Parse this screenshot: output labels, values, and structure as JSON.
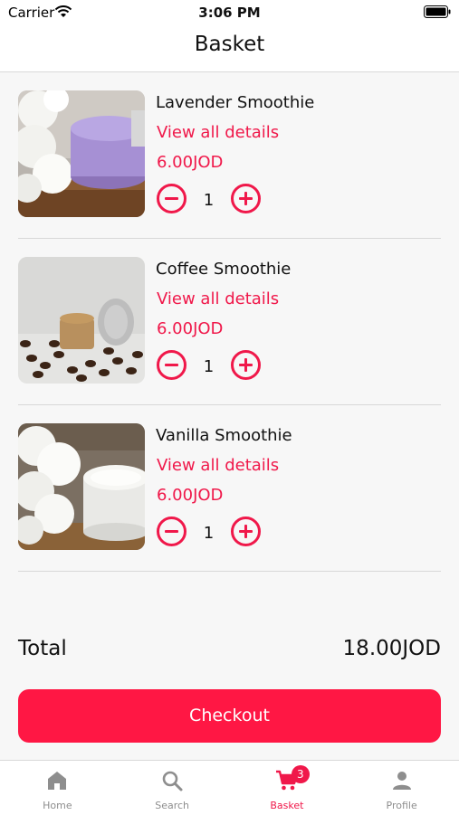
{
  "status_bar": {
    "carrier": "Carrier",
    "time": "3:06 PM"
  },
  "header": {
    "title": "Basket"
  },
  "colors": {
    "accent": "#f0184a",
    "checkout_bg": "#ff1744",
    "tab_inactive": "#8e8e8e"
  },
  "basket": {
    "items": [
      {
        "name": "Lavender Smoothie",
        "link": "View all details",
        "price": "6.00JOD",
        "quantity": "1",
        "image": "lavender-jar-image"
      },
      {
        "name": "Coffee Smoothie",
        "link": "View all details",
        "price": "6.00JOD",
        "quantity": "1",
        "image": "coffee-jar-image"
      },
      {
        "name": "Vanilla Smoothie",
        "link": "View all details",
        "price": "6.00JOD",
        "quantity": "1",
        "image": "vanilla-jar-image"
      }
    ]
  },
  "total": {
    "label": "Total",
    "value": "18.00JOD"
  },
  "checkout": {
    "label": "Checkout"
  },
  "tabs": [
    {
      "label": "Home",
      "icon": "home-icon",
      "active": false
    },
    {
      "label": "Search",
      "icon": "search-icon",
      "active": false
    },
    {
      "label": "Basket",
      "icon": "cart-icon",
      "active": true,
      "badge": "3"
    },
    {
      "label": "Profile",
      "icon": "person-icon",
      "active": false
    }
  ]
}
